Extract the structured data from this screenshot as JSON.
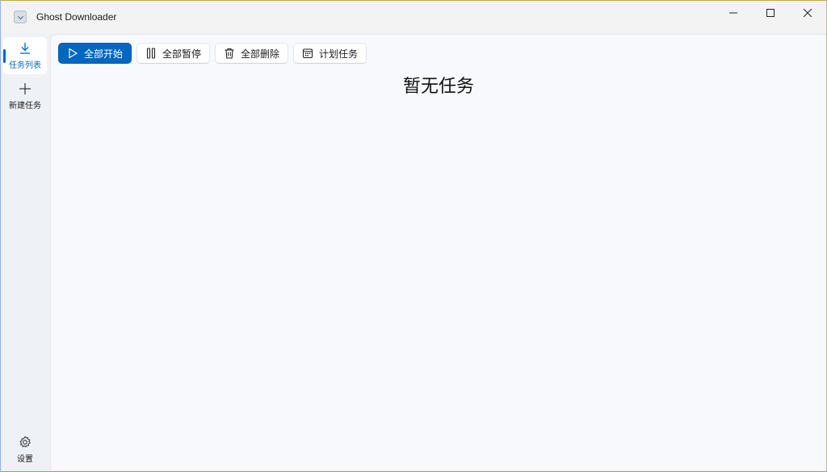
{
  "app": {
    "title": "Ghost Downloader"
  },
  "window_controls": {
    "minimize": "—",
    "maximize": "☐",
    "close": "✕"
  },
  "sidebar": {
    "items": [
      {
        "label": "任务列表",
        "icon": "download-icon",
        "active": true
      },
      {
        "label": "新建任务",
        "icon": "plus-icon",
        "active": false
      }
    ],
    "settings": {
      "label": "设置",
      "icon": "gear-icon"
    }
  },
  "toolbar": {
    "start_all": "全部开始",
    "pause_all": "全部暂停",
    "delete_all": "全部删除",
    "schedule": "计划任务"
  },
  "main": {
    "empty_text": "暂无任务"
  },
  "colors": {
    "accent": "#0067c0"
  }
}
